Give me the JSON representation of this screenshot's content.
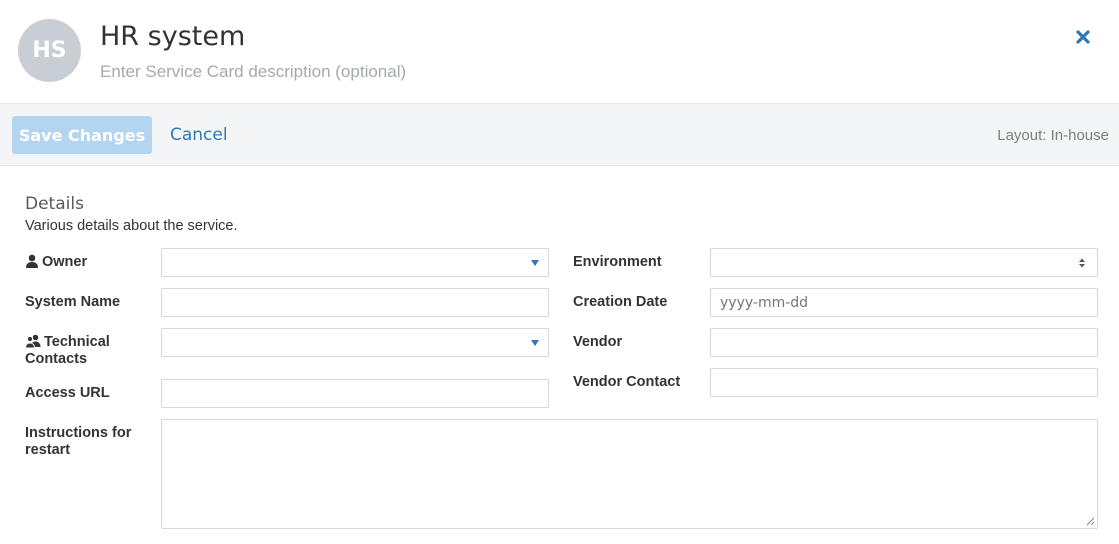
{
  "header": {
    "avatar_initials": "HS",
    "title": "HR system",
    "description_placeholder": "Enter Service Card description (optional)",
    "close_icon": "close-icon"
  },
  "toolbar": {
    "save_label": "Save Changes",
    "cancel_label": "Cancel",
    "layout_label": "Layout: In-house"
  },
  "details": {
    "title": "Details",
    "subtitle": "Various details about the service.",
    "left": {
      "owner_label": "Owner",
      "owner_value": "",
      "system_name_label": "System Name",
      "system_name_value": "",
      "technical_contacts_label_line1": "Technical",
      "technical_contacts_label_line2": "Contacts",
      "technical_contacts_value": "",
      "access_url_label": "Access URL",
      "access_url_value": ""
    },
    "right": {
      "environment_label": "Environment",
      "environment_value": "",
      "creation_date_label": "Creation Date",
      "creation_date_placeholder": "yyyy-mm-dd",
      "vendor_label": "Vendor",
      "vendor_value": "",
      "vendor_contact_label": "Vendor Contact",
      "vendor_contact_value": ""
    },
    "instructions_label_line1": "Instructions for",
    "instructions_label_line2": "restart",
    "instructions_value": ""
  },
  "colors": {
    "accent": "#2f78b6",
    "save_disabled": "#b4d5ef",
    "toolbar_bg": "#f4f5f7",
    "avatar_bg": "#c8ced3"
  }
}
